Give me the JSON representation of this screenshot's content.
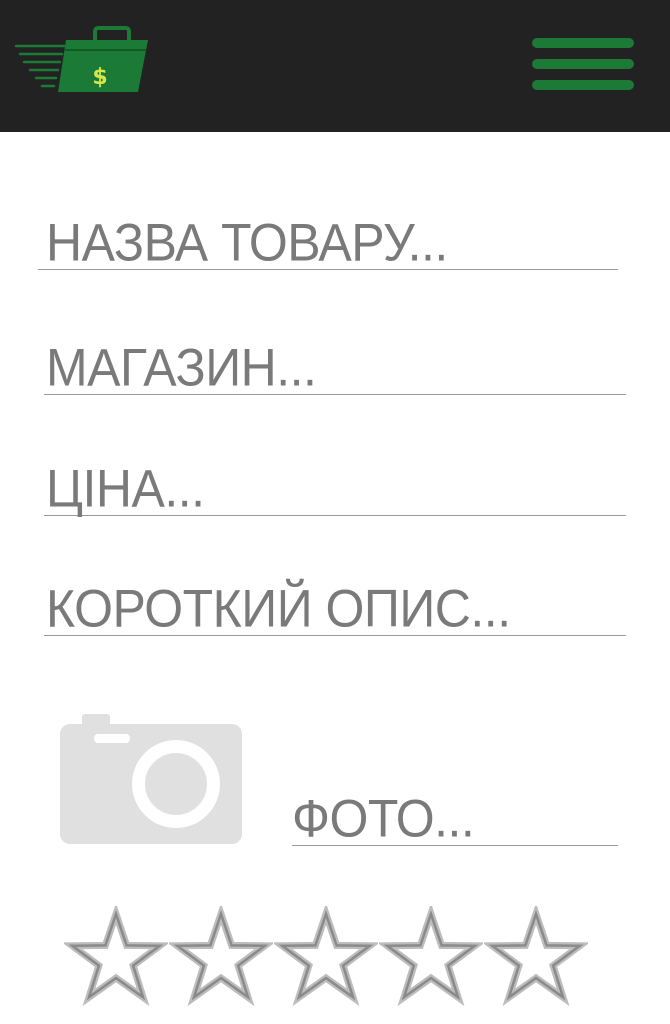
{
  "header": {
    "logo_icon": "money-briefcase-icon",
    "menu_icon": "hamburger-menu-icon",
    "accent_color": "#1b7a35",
    "background_color": "#222222"
  },
  "form": {
    "product_name_placeholder": "НАЗВА ТОВАРУ...",
    "store_placeholder": "МАГАЗИН...",
    "price_placeholder": "ЦІНА...",
    "description_placeholder": "КОРОТКИЙ ОПИС...",
    "photo_placeholder": "ФОТО...",
    "photo_icon": "camera-icon"
  },
  "rating": {
    "max": 5,
    "value": 0,
    "star_icon": "star-outline-icon"
  }
}
